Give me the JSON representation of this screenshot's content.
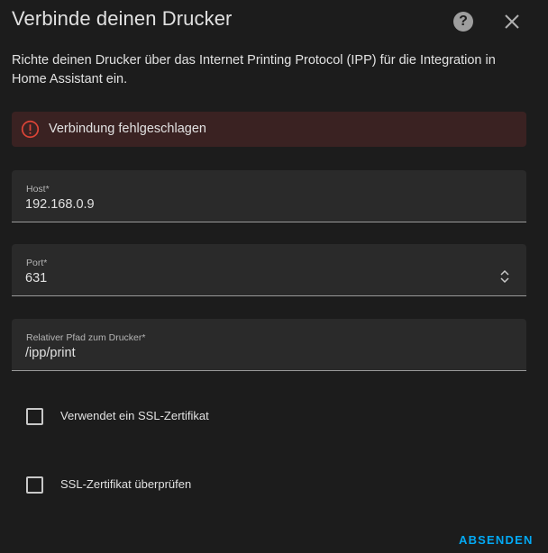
{
  "dialog": {
    "title": "Verbinde deinen Drucker",
    "description": "Richte deinen Drucker über das Internet Printing Protocol (IPP) für die Integration in Home Assistant ein.",
    "help_icon": "help-circle-icon",
    "close_icon": "close-icon"
  },
  "error": {
    "icon": "alert-circle-icon",
    "message": "Verbindung fehlgeschlagen",
    "color": "#db4437"
  },
  "fields": {
    "host": {
      "label": "Host*",
      "value": "192.168.0.9"
    },
    "port": {
      "label": "Port*",
      "value": "631"
    },
    "path": {
      "label": "Relativer Pfad zum Drucker*",
      "value": "/ipp/print"
    }
  },
  "checkboxes": {
    "ssl": {
      "label": "Verwendet ein SSL-Zertifikat",
      "checked": false
    },
    "verify_ssl": {
      "label": "SSL-Zertifikat überprüfen",
      "checked": false
    }
  },
  "actions": {
    "submit_label": "ABSENDEN",
    "accent": "#03a9f4"
  }
}
